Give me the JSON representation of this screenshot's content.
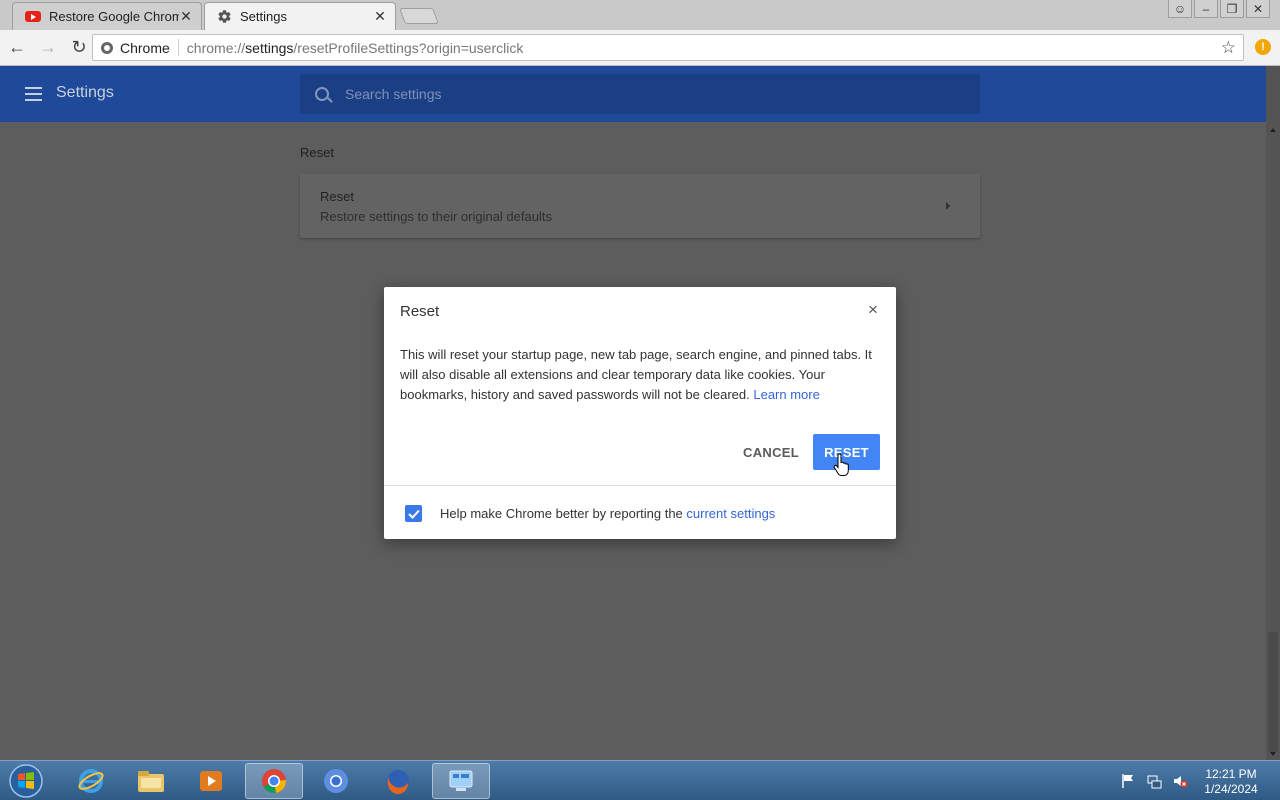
{
  "tabs": [
    {
      "title": "Restore Google Chrome",
      "icon": "youtube-icon",
      "active": false
    },
    {
      "title": "Settings",
      "icon": "gear-icon",
      "active": true
    }
  ],
  "omnibox": {
    "chip_label": "Chrome",
    "url_scheme": "chrome://",
    "url_host": "settings",
    "url_path": "/resetProfileSettings?origin=userclick"
  },
  "app_header": {
    "title": "Settings",
    "search_placeholder": "Search settings"
  },
  "section": {
    "label": "Reset",
    "card_title": "Reset",
    "card_subtitle": "Restore settings to their original defaults"
  },
  "dialog": {
    "title": "Reset",
    "close_glyph": "×",
    "body": "This will reset your startup page, new tab page, search engine, and pinned tabs. It will also disable all extensions and clear temporary data like cookies. Your bookmarks, history and saved passwords will not be cleared.",
    "learn_more": "Learn more",
    "cancel_label": "CANCEL",
    "reset_label": "RESET",
    "report_checked": true,
    "footer_text": "Help make Chrome better by reporting the",
    "footer_link": "current settings"
  },
  "taskbar": {
    "time": "12:21 PM",
    "date": "1/24/2024"
  },
  "colors": {
    "header_blue": "#1f4a99",
    "accent_blue": "#4285f4",
    "link_blue": "#3367d6"
  }
}
